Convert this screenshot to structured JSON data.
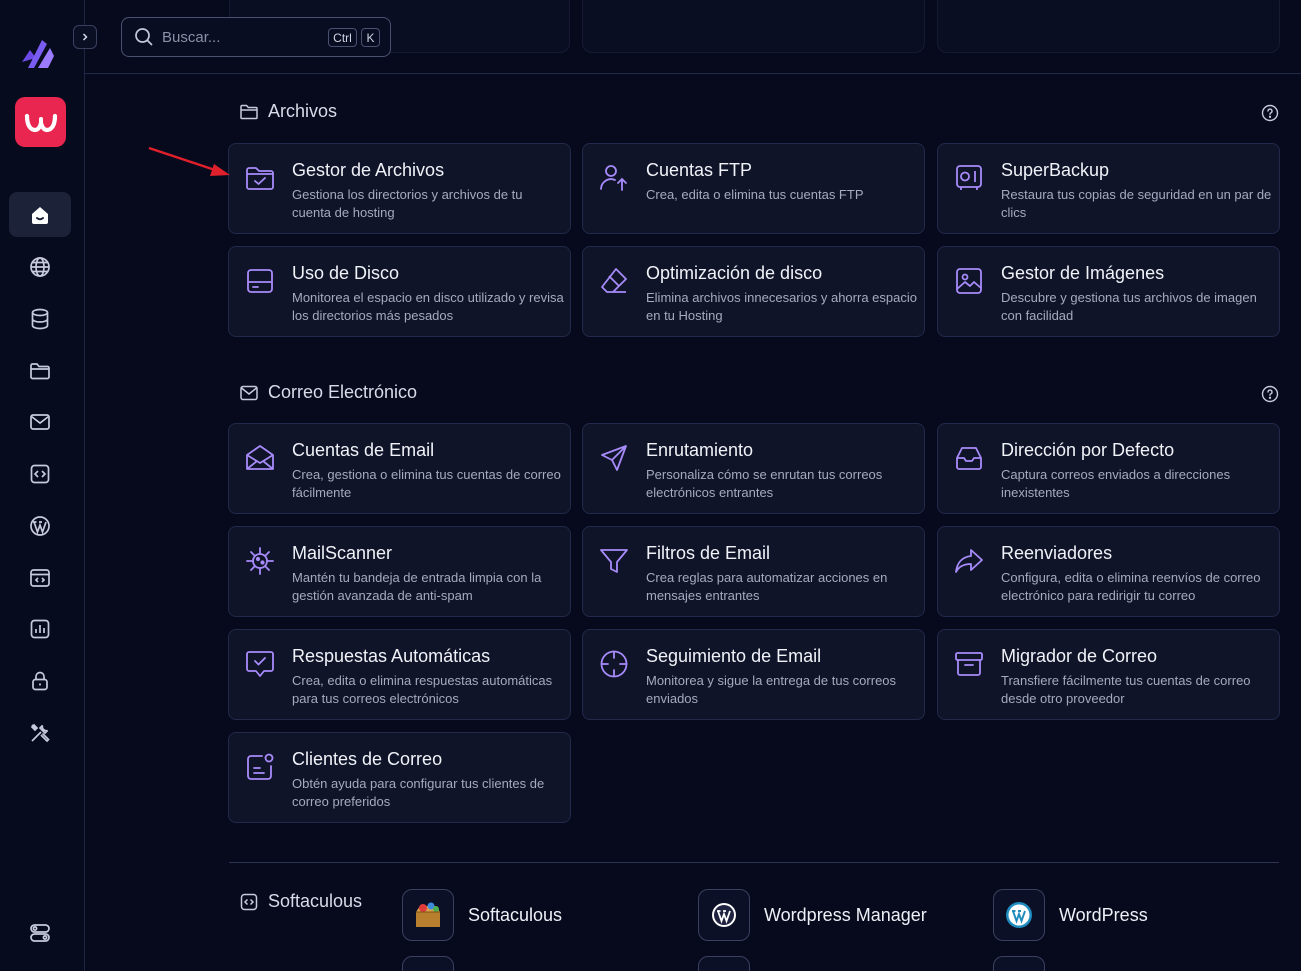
{
  "search": {
    "placeholder": "Buscar...",
    "kbd_ctrl": "Ctrl",
    "kbd_k": "K"
  },
  "sections": {
    "archivos": {
      "title": "Archivos"
    },
    "correo": {
      "title": "Correo Electrónico"
    },
    "softaculous": {
      "title": "Softaculous"
    }
  },
  "archivos_cards": [
    {
      "title": "Gestor de Archivos",
      "desc": "Gestiona los directorios y archivos de tu cuenta de hosting",
      "icon": "folder-check-icon"
    },
    {
      "title": "Cuentas FTP",
      "desc": "Crea, edita o elimina tus cuentas FTP",
      "icon": "user-upload-icon"
    },
    {
      "title": "SuperBackup",
      "desc": "Restaura tus copias de seguridad en un par de clics",
      "icon": "safe-icon"
    },
    {
      "title": "Uso de Disco",
      "desc": "Monitorea el espacio en disco utilizado y revisa los directorios más pesados",
      "icon": "hard-drive-icon"
    },
    {
      "title": "Optimización de disco",
      "desc": "Elimina archivos innecesarios y ahorra espacio en tu Hosting",
      "icon": "eraser-icon"
    },
    {
      "title": "Gestor de Imágenes",
      "desc": "Descubre y gestiona tus archivos de imagen con facilidad",
      "icon": "image-icon"
    }
  ],
  "correo_cards": [
    {
      "title": "Cuentas de Email",
      "desc": "Crea, gestiona o elimina tus cuentas de correo fácilmente",
      "icon": "envelope-open-icon"
    },
    {
      "title": "Enrutamiento",
      "desc": "Personaliza cómo se enrutan tus correos electrónicos entrantes",
      "icon": "send-icon"
    },
    {
      "title": "Dirección por Defecto",
      "desc": "Captura correos enviados a direcciones inexistentes",
      "icon": "inbox-icon"
    },
    {
      "title": "MailScanner",
      "desc": "Mantén tu bandeja de entrada limpia con la gestión avanzada de anti-spam",
      "icon": "virus-icon"
    },
    {
      "title": "Filtros de Email",
      "desc": "Crea reglas para automatizar acciones en mensajes entrantes",
      "icon": "filter-icon"
    },
    {
      "title": "Reenviadores",
      "desc": "Configura, edita o elimina reenvíos de correo electrónico para redirigir tu correo",
      "icon": "forward-icon"
    },
    {
      "title": "Respuestas Automáticas",
      "desc": "Crea, edita o elimina respuestas automáticas para tus correos electrónicos",
      "icon": "message-check-icon"
    },
    {
      "title": "Seguimiento de Email",
      "desc": "Monitorea y sigue la entrega de tus correos enviados",
      "icon": "crosshair-icon"
    },
    {
      "title": "Migrador de Correo",
      "desc": "Transfiere fácilmente tus cuentas de correo desde otro proveedor",
      "icon": "archive-icon"
    },
    {
      "title": "Clientes de Correo",
      "desc": "Obtén ayuda para configurar tus clientes de correo preferidos",
      "icon": "client-notification-icon"
    }
  ],
  "apps": [
    {
      "label": "Softaculous",
      "icon": "softaculous-box-icon"
    },
    {
      "label": "Wordpress Manager",
      "icon": "wordpress-manager-icon"
    },
    {
      "label": "WordPress",
      "icon": "wordpress-icon"
    }
  ],
  "colors": {
    "accent": "#a78bfa",
    "brand": "#e8264f",
    "background": "#060a1c",
    "card": "#0f1429",
    "annotation_arrow": "#e0202a"
  }
}
